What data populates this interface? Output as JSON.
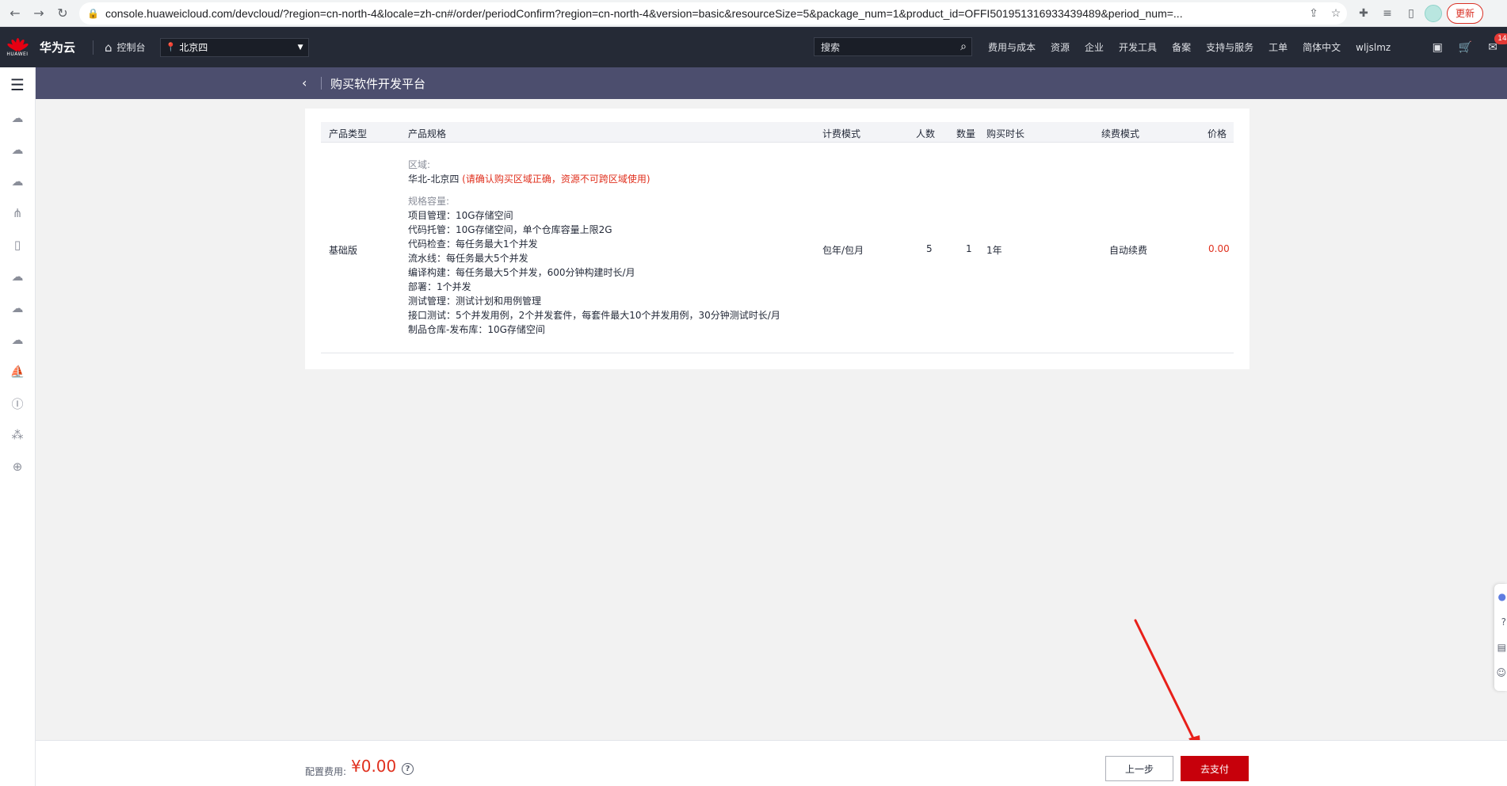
{
  "browser": {
    "url": "console.huaweicloud.com/devcloud/?region=cn-north-4&locale=zh-cn#/order/periodConfirm?region=cn-north-4&version=basic&resourceSize=5&package_num=1&product_id=OFFI501951316933439489&period_num=...",
    "update_label": "更新"
  },
  "header": {
    "brand": "华为云",
    "logo_text": "HUAWEI",
    "console_label": "控制台",
    "region": "北京四",
    "search_placeholder": "搜索",
    "nav": [
      "费用与成本",
      "资源",
      "企业",
      "开发工具",
      "备案",
      "支持与服务",
      "工单",
      "简体中文",
      "wljslmz"
    ],
    "message_count": "14"
  },
  "page": {
    "title": "购买软件开发平台"
  },
  "table": {
    "headers": [
      "产品类型",
      "产品规格",
      "计费模式",
      "人数",
      "数量",
      "购买时长",
      "续费模式",
      "价格"
    ],
    "row": {
      "product_type": "基础版",
      "region_label": "区域:",
      "region_value": "华北-北京四",
      "region_warning": "(请确认购买区域正确，资源不可跨区域使用)",
      "spec_label": "规格容量:",
      "spec_lines": [
        "项目管理：10G存储空间",
        "代码托管：10G存储空间，单个仓库容量上限2G",
        "代码检查：每任务最大1个并发",
        "流水线：每任务最大5个并发",
        "编译构建：每任务最大5个并发，600分钟构建时长/月",
        "部署：1个并发",
        "测试管理：测试计划和用例管理",
        "接口测试：5个并发用例，2个并发套件，每套件最大10个并发用例，30分钟测试时长/月",
        "制品仓库-发布库：10G存储空间"
      ],
      "billing": "包年/包月",
      "people": "5",
      "quantity": "1",
      "duration": "1年",
      "renewal": "自动续费",
      "price": "0.00"
    }
  },
  "footer": {
    "fee_label": "配置费用:",
    "fee_value": "¥0.00",
    "prev_label": "上一步",
    "pay_label": "去支付"
  },
  "colors": {
    "topbar": "#252a36",
    "title_band": "#4c4e6e",
    "accent_red": "#c7000b",
    "price_red": "#e0301e"
  }
}
